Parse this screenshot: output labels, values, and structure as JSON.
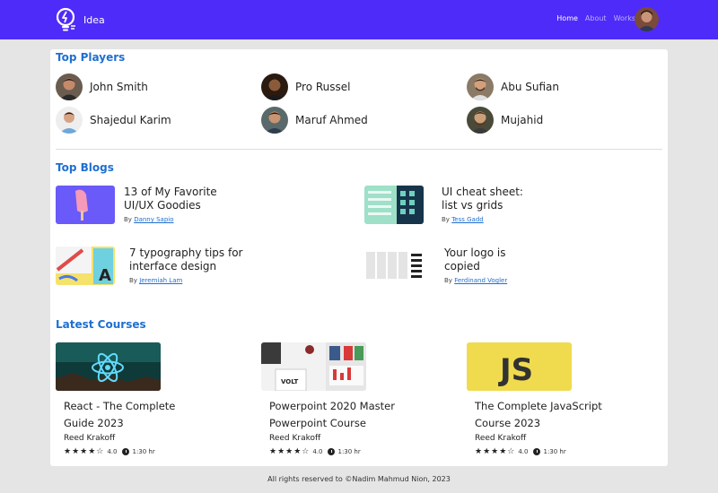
{
  "nav": {
    "brand": "Idea",
    "links": [
      "Home",
      "About",
      "Works"
    ],
    "avatar_icon": "user-avatar",
    "color": "#4f2bf9"
  },
  "players": {
    "title": "Top Players",
    "items": [
      "John Smith",
      "Pro Russel",
      "Abu Sufian",
      "Shajedul Karim",
      "Maruf Ahmed",
      "Mujahid"
    ]
  },
  "blogs": {
    "title": "Top Blogs",
    "by_label": "By",
    "items": [
      {
        "title": "13 of My Favorite UI/UX Goodies",
        "author": "Danny Sapio"
      },
      {
        "title": "UI cheat sheet: list vs grids",
        "author": "Tess Gadd"
      },
      {
        "title": "7 typography tips for interface design",
        "author": "Jeremiah Lam"
      },
      {
        "title": "Your logo is copied",
        "author": "Ferdinand Vogler"
      }
    ]
  },
  "courses": {
    "title": "Latest Courses",
    "items": [
      {
        "title": "React - The Complete Guide 2023",
        "author": "Reed Krakoff",
        "rating": "4.0",
        "stars": "★★★★☆",
        "duration": "1:30 hr"
      },
      {
        "title": "Powerpoint 2020 Master Powerpoint Course",
        "author": "Reed Krakoff",
        "rating": "4.0",
        "stars": "★★★★☆",
        "duration": "1:30 hr"
      },
      {
        "title": "The Complete JavaScript Course 2023",
        "author": "Reed Krakoff",
        "rating": "4.0",
        "stars": "★★★★☆",
        "duration": "1:30 hr"
      }
    ]
  },
  "thumb_text": {
    "volt": "VOLT",
    "js": "JS"
  },
  "footer": "All rights reserved to ©Nadim Mahmud Nion, 2023"
}
